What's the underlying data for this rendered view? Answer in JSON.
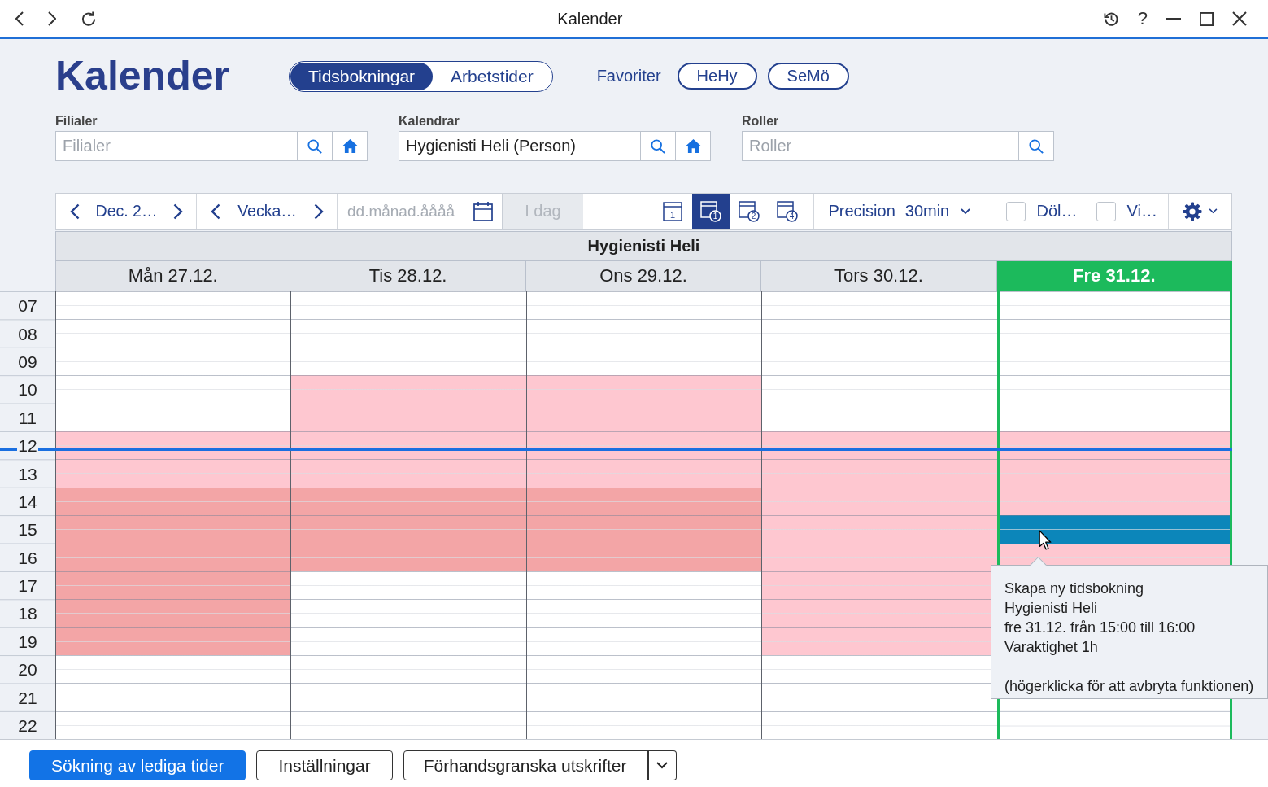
{
  "window": {
    "title": "Kalender",
    "help": "?"
  },
  "header": {
    "title": "Kalender",
    "tabs": [
      {
        "label": "Tidsbokningar",
        "selected": true
      },
      {
        "label": "Arbetstider",
        "selected": false
      }
    ],
    "favorites_label": "Favoriter",
    "favorites": [
      "HeHy",
      "SeMö"
    ]
  },
  "filters": [
    {
      "label": "Filialer",
      "placeholder": "Filialer",
      "home_button": true
    },
    {
      "label": "Kalendrar",
      "value": "Hygienisti Heli (Person)",
      "home_button": true
    },
    {
      "label": "Roller",
      "placeholder": "Roller",
      "home_button": false
    }
  ],
  "toolbar": {
    "month": "Dec. 2…",
    "week": "Vecka…",
    "date_placeholder": "dd.månad.åååå",
    "today": {
      "label": "I dag",
      "disabled": true
    },
    "views": [
      {
        "kind": "page",
        "number": "1",
        "selected": false
      },
      {
        "kind": "circled",
        "number": "1",
        "selected": true
      },
      {
        "kind": "circled",
        "number": "2",
        "selected": false
      },
      {
        "kind": "circled",
        "number": "4",
        "selected": false
      }
    ],
    "precision": {
      "label": "Precision",
      "value": "30min"
    },
    "checkboxes": [
      {
        "label": "Döl…",
        "checked": false
      },
      {
        "label": "Vi…",
        "checked": false
      }
    ]
  },
  "calendar": {
    "person": "Hygienisti Heli",
    "days": [
      {
        "label": "Mån 27.12.",
        "today": false,
        "slots": [
          {
            "color": "#ffffff"
          },
          {
            "color": "#ffffff"
          },
          {
            "color": "#ffffff"
          },
          {
            "color": "#ffffff"
          },
          {
            "color": "#ffffff"
          },
          {
            "color": "#fec7d0"
          },
          {
            "color": "#fec7d0"
          },
          {
            "color": "#f3a5a6"
          },
          {
            "color": "#f3a5a6"
          },
          {
            "color": "#f3a5a6"
          },
          {
            "color": "#f3a5a6"
          },
          {
            "color": "#f3a5a6"
          },
          {
            "color": "#f3a5a6"
          },
          {
            "color": "#ffffff"
          },
          {
            "color": "#ffffff"
          },
          {
            "color": "#ffffff"
          }
        ]
      },
      {
        "label": "Tis 28.12.",
        "today": false,
        "slots": [
          {
            "color": "#ffffff"
          },
          {
            "color": "#ffffff"
          },
          {
            "color": "#ffffff"
          },
          {
            "color": "#fec7d0"
          },
          {
            "color": "#fec7d0"
          },
          {
            "color": "#fec7d0"
          },
          {
            "color": "#fec7d0"
          },
          {
            "color": "#f3a5a6"
          },
          {
            "color": "#f3a5a6"
          },
          {
            "color": "#f3a5a6"
          },
          {
            "color": "#ffffff"
          },
          {
            "color": "#ffffff"
          },
          {
            "color": "#ffffff"
          },
          {
            "color": "#ffffff"
          },
          {
            "color": "#ffffff"
          },
          {
            "color": "#ffffff"
          }
        ]
      },
      {
        "label": "Ons 29.12.",
        "today": false,
        "slots": [
          {
            "color": "#ffffff"
          },
          {
            "color": "#ffffff"
          },
          {
            "color": "#ffffff"
          },
          {
            "color": "#fec7d0"
          },
          {
            "color": "#fec7d0"
          },
          {
            "color": "#fec7d0"
          },
          {
            "color": "#fec7d0"
          },
          {
            "color": "#f3a5a6"
          },
          {
            "color": "#f3a5a6"
          },
          {
            "color": "#f3a5a6"
          },
          {
            "color": "#ffffff"
          },
          {
            "color": "#ffffff"
          },
          {
            "color": "#ffffff"
          },
          {
            "color": "#ffffff"
          },
          {
            "color": "#ffffff"
          },
          {
            "color": "#ffffff"
          }
        ]
      },
      {
        "label": "Tors 30.12.",
        "today": false,
        "slots": [
          {
            "color": "#ffffff"
          },
          {
            "color": "#ffffff"
          },
          {
            "color": "#ffffff"
          },
          {
            "color": "#ffffff"
          },
          {
            "color": "#ffffff"
          },
          {
            "color": "#fec7d0"
          },
          {
            "color": "#fec7d0"
          },
          {
            "color": "#fec7d0"
          },
          {
            "color": "#fec7d0"
          },
          {
            "color": "#fec7d0"
          },
          {
            "color": "#fec7d0"
          },
          {
            "color": "#fec7d0"
          },
          {
            "color": "#fec7d0"
          },
          {
            "color": "#ffffff"
          },
          {
            "color": "#ffffff"
          },
          {
            "color": "#ffffff"
          }
        ]
      },
      {
        "label": "Fre 31.12.",
        "today": true,
        "slots": [
          {
            "color": "#ffffff"
          },
          {
            "color": "#ffffff"
          },
          {
            "color": "#ffffff"
          },
          {
            "color": "#ffffff"
          },
          {
            "color": "#ffffff"
          },
          {
            "color": "#fec7d0"
          },
          {
            "color": "#fec7d0"
          },
          {
            "color": "#fec7d0"
          },
          {
            "color": "#0c86ba"
          },
          {
            "color": "#fec7d0"
          }
        ]
      }
    ],
    "hours": [
      "07",
      "08",
      "09",
      "10",
      "11",
      "12",
      "13",
      "14",
      "15",
      "16",
      "17",
      "18",
      "19",
      "20",
      "21",
      "22"
    ],
    "tooltip": {
      "lines": [
        "Skapa ny tidsbokning",
        "Hygienisti Heli",
        "fre 31.12. från 15:00 till 16:00",
        "Varaktighet 1h"
      ],
      "hint": "(högerklicka för att avbryta funktionen)"
    }
  },
  "actions": [
    {
      "label": "Sökning av lediga tider",
      "kind": "primary"
    },
    {
      "label": "Inställningar",
      "kind": "secondary"
    },
    {
      "label": "Förhandsgranska utskrifter",
      "kind": "split"
    }
  ]
}
